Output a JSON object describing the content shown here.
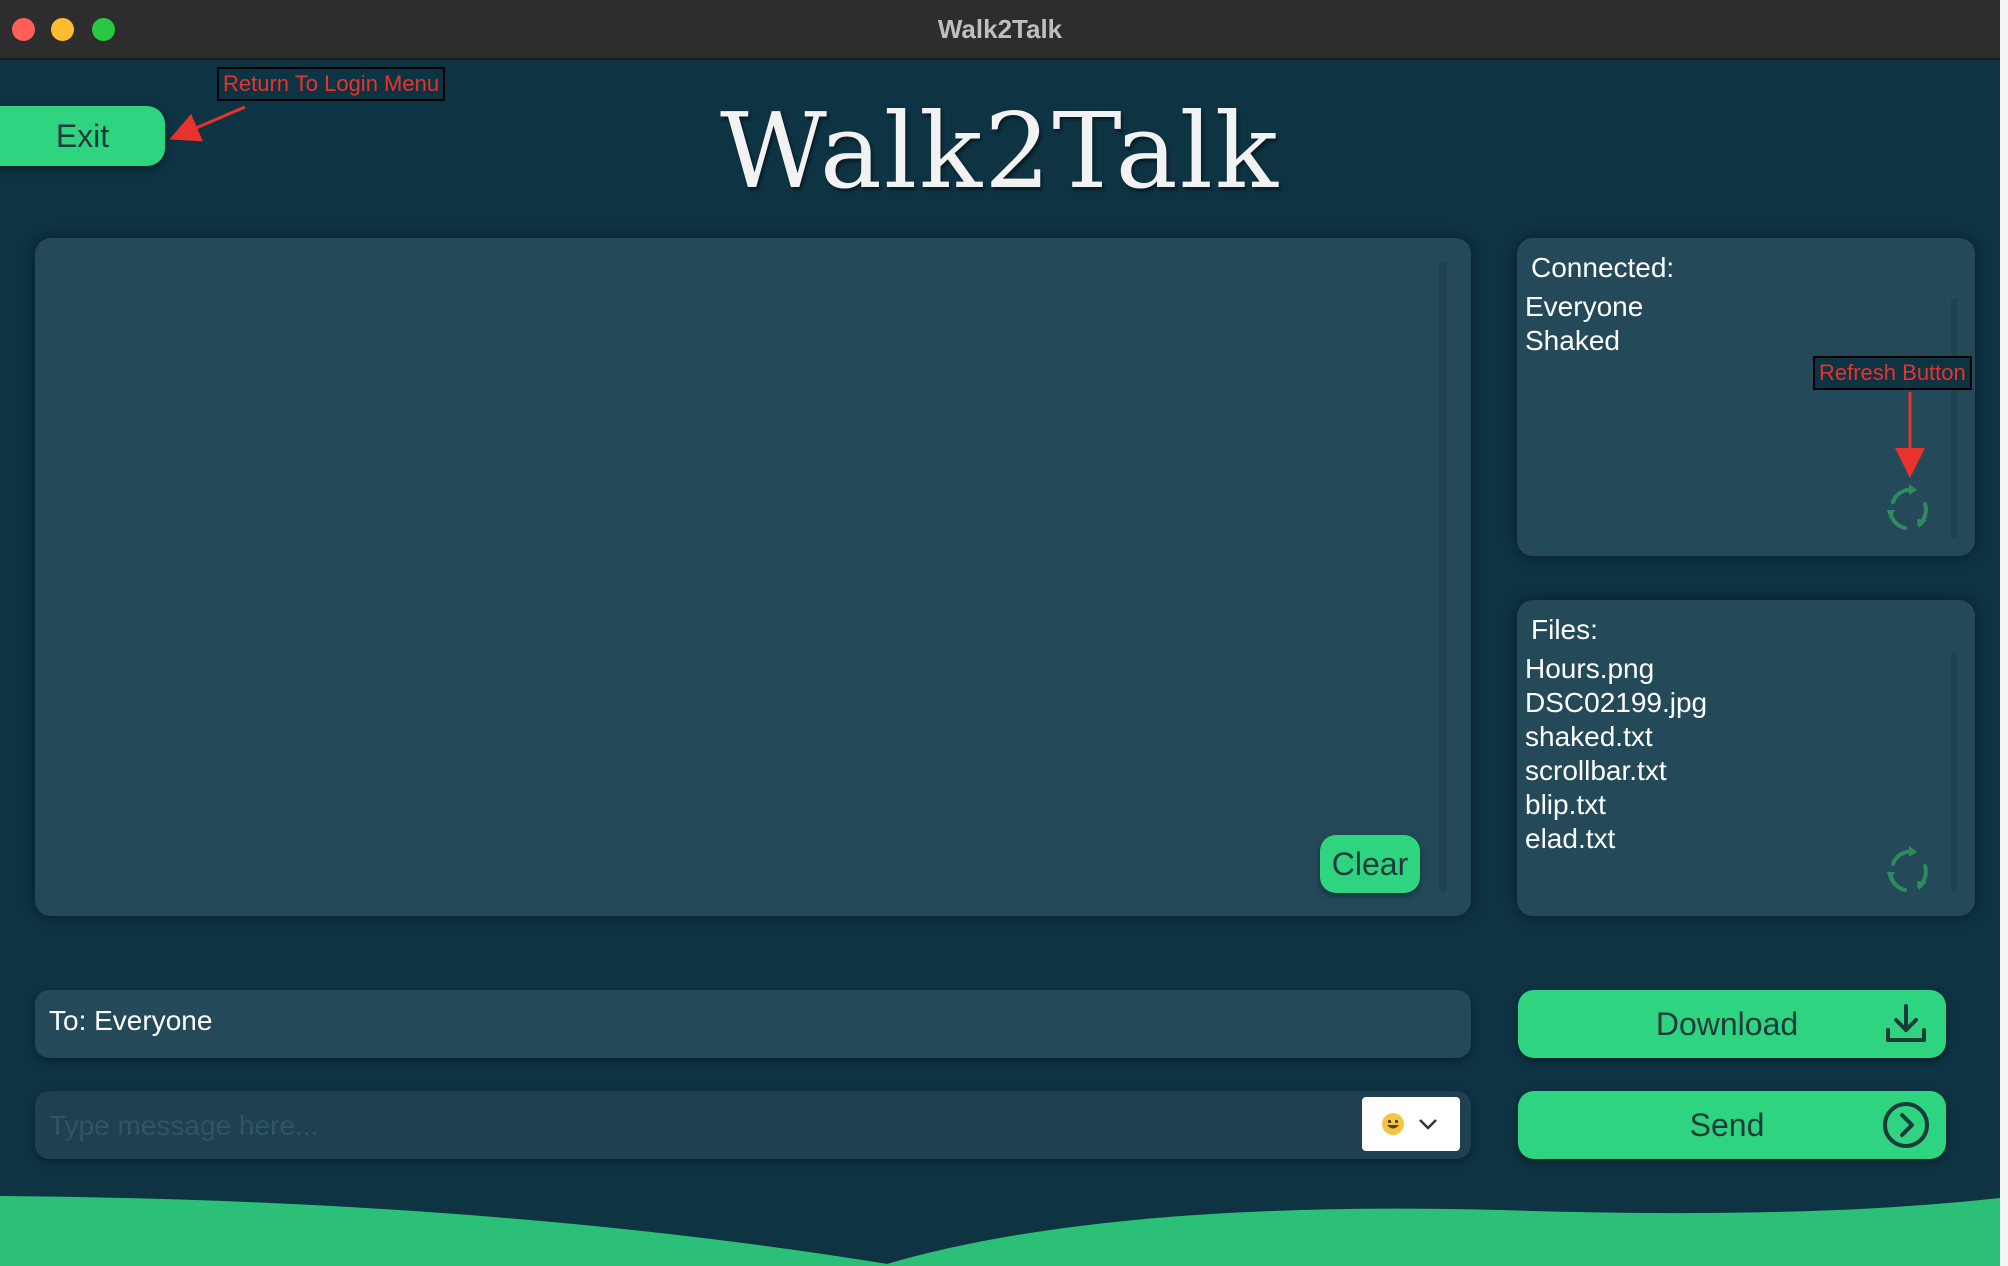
{
  "window": {
    "title": "Walk2Talk"
  },
  "header": {
    "exit_label": "Exit",
    "logo_text": "Walk2Talk"
  },
  "chat": {
    "clear_label": "Clear"
  },
  "connected": {
    "heading": "Connected:",
    "users": [
      "Everyone",
      "Shaked"
    ]
  },
  "files": {
    "heading": "Files:",
    "items": [
      "Hours.png",
      "DSC02199.jpg",
      "shaked.txt",
      "scrollbar.txt",
      "blip.txt",
      "elad.txt"
    ]
  },
  "composer": {
    "to_label": "To: Everyone",
    "message_placeholder": "Type message here...",
    "emoji_icon": "grinning-face-emoji"
  },
  "actions": {
    "download_label": "Download",
    "send_label": "Send"
  },
  "annotations": {
    "login": "Return To Login Menu",
    "refresh": "Refresh Button"
  },
  "colors": {
    "background": "#0e3343",
    "panel": "#244a5a",
    "accent_green": "#2ed47f",
    "annotation_red": "#e8322d"
  }
}
